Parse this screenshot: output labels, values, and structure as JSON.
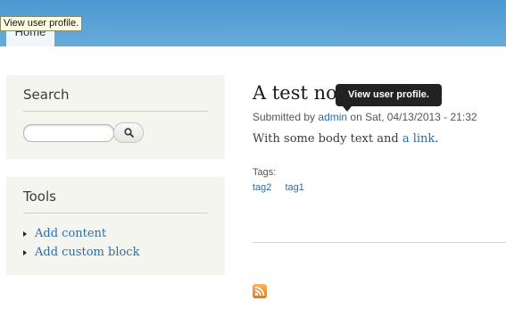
{
  "header": {
    "home_tab": "Home",
    "tooltip": "View user profile."
  },
  "search_block": {
    "title": "Search",
    "input_value": "",
    "button_icon": "search-icon"
  },
  "tools_block": {
    "title": "Tools",
    "items": [
      {
        "label": "Add content"
      },
      {
        "label": "Add custom block"
      }
    ]
  },
  "node": {
    "title": "A test node",
    "submitted_prefix": "Submitted by",
    "author": "admin",
    "submitted_suffix": "on Sat, 04/13/2013 - 21:32",
    "tooltip": "View user profile.",
    "body_prefix": "With some body text and",
    "body_link": "a link",
    "body_suffix": ".",
    "tags_label": "Tags:",
    "tags": [
      "tag2",
      "tag1"
    ]
  },
  "feed": {
    "icon": "rss-icon"
  },
  "colors": {
    "header": "#5aa3d8",
    "link": "#2c6da3",
    "sidebar_block": "#f5f5f0",
    "tooltip_dark": "#222222",
    "tooltip_light": "#ffffe1"
  }
}
